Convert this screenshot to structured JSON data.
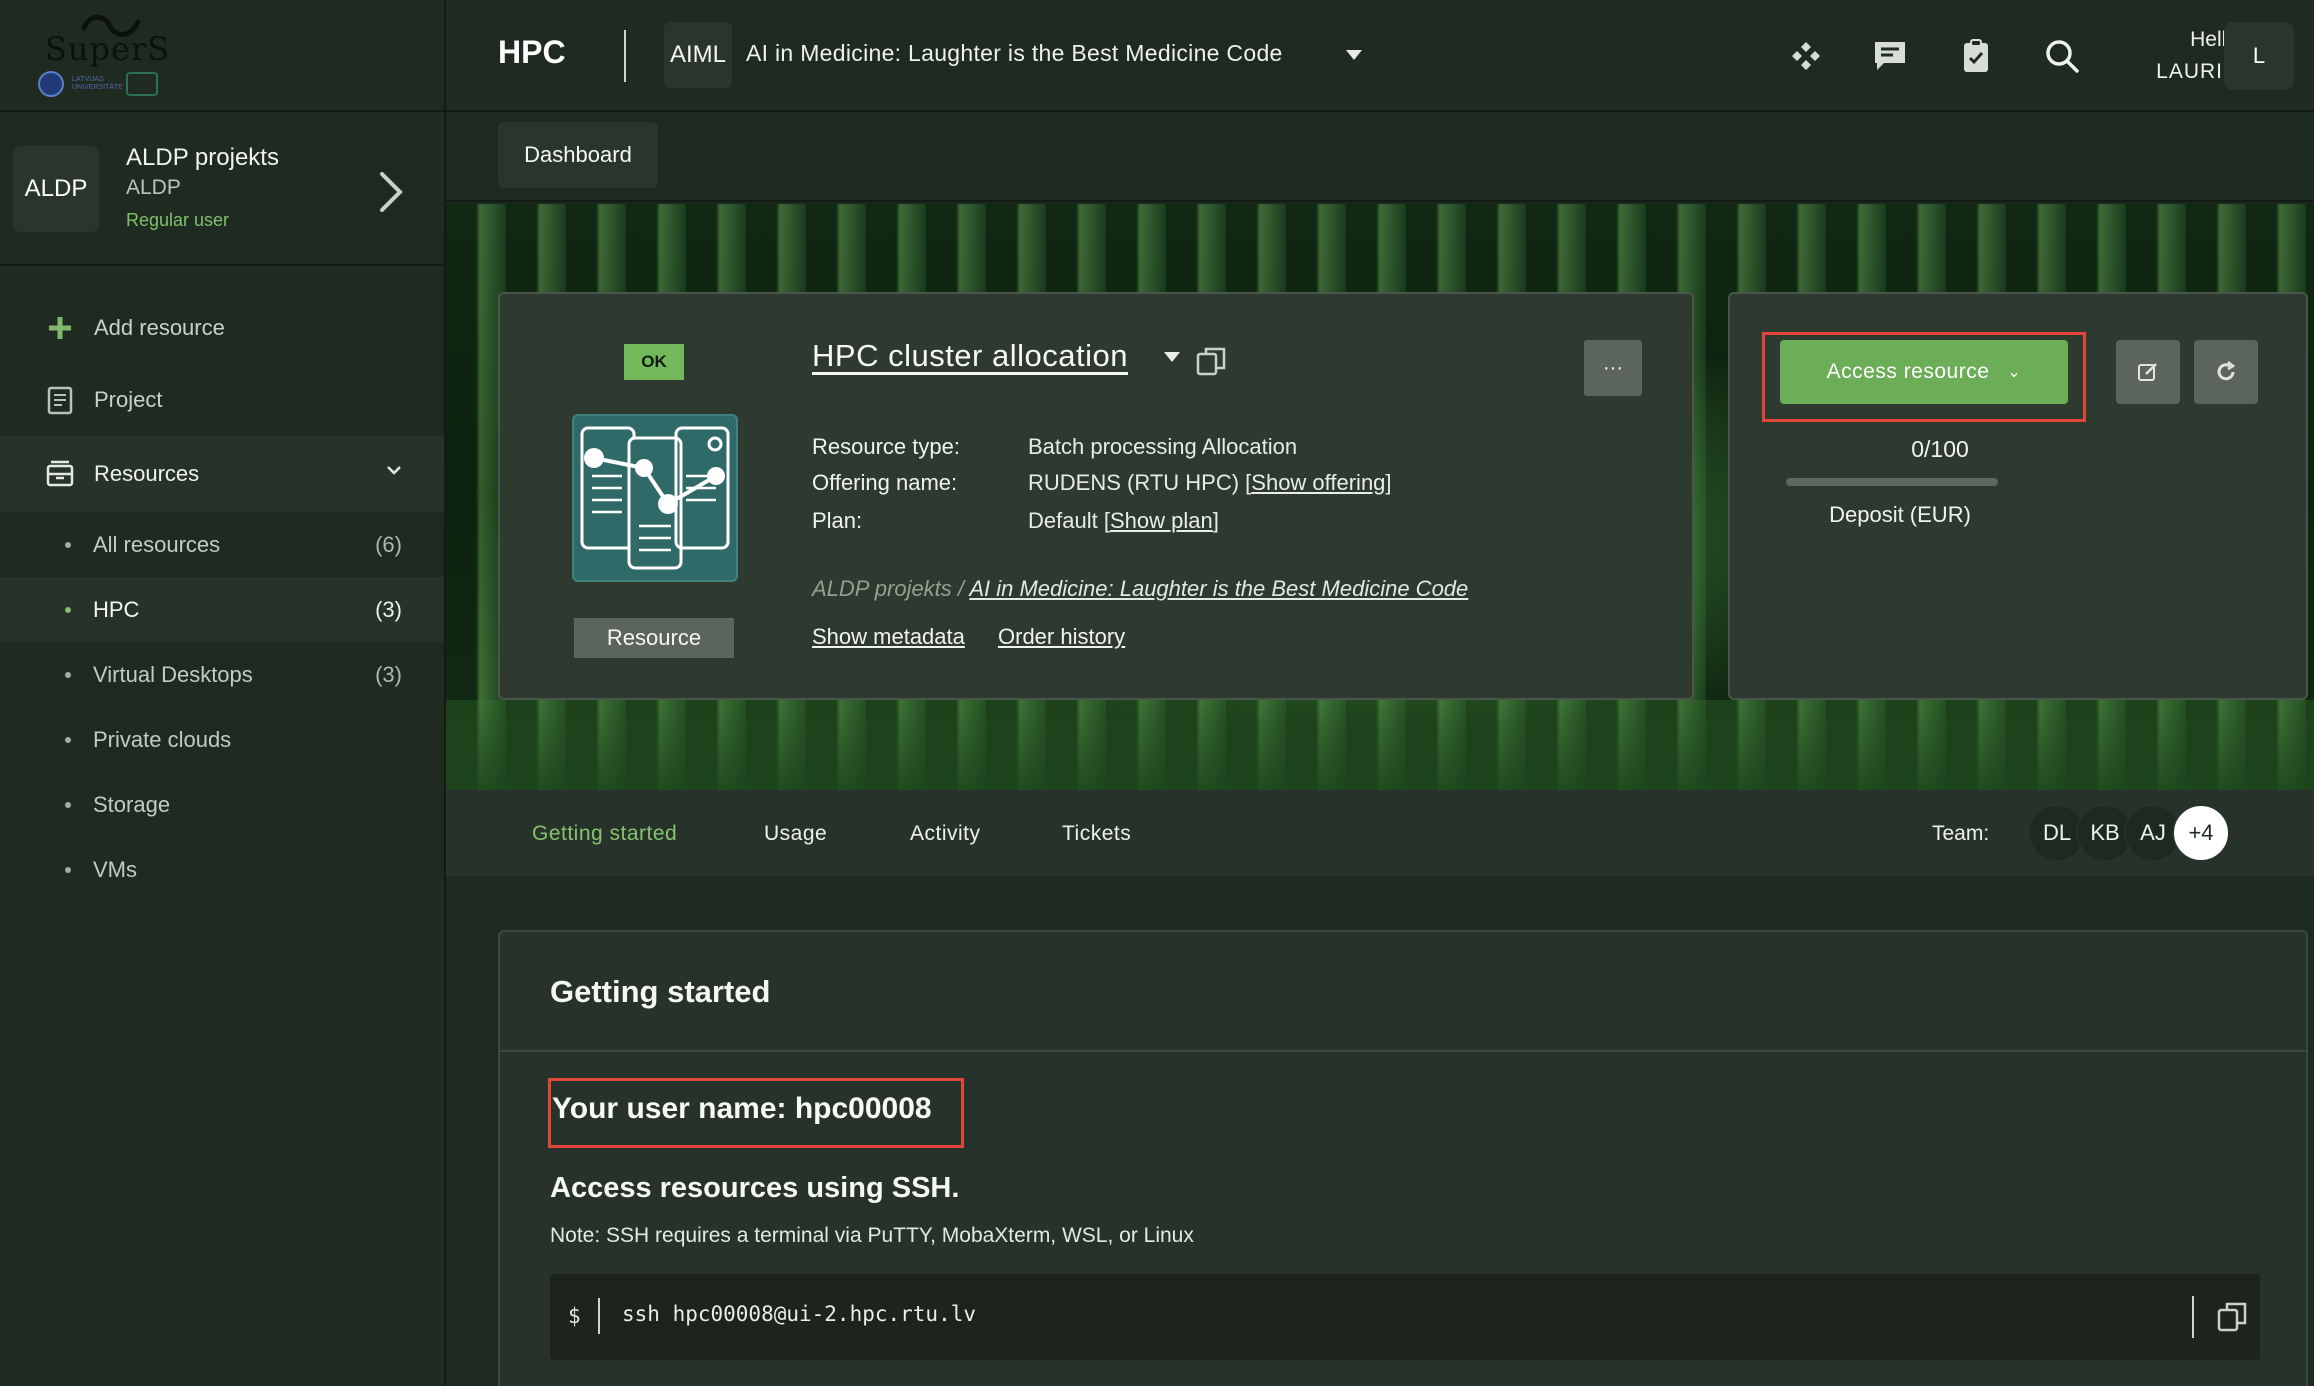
{
  "sidebar": {
    "logo": {
      "text": "SuperS",
      "sub_text": "LATVIJAS UNIVERSITĀTE"
    },
    "project": {
      "avatar": "ALDP",
      "name": "ALDP projekts",
      "code": "ALDP",
      "role": "Regular user"
    },
    "nav": {
      "add_resource": "Add resource",
      "project": "Project",
      "resources": "Resources"
    },
    "resources": [
      {
        "label": "All resources",
        "count": "(6)"
      },
      {
        "label": "HPC",
        "count": "(3)"
      },
      {
        "label": "Virtual Desktops",
        "count": "(3)"
      },
      {
        "label": "Private clouds",
        "count": ""
      },
      {
        "label": "Storage",
        "count": ""
      },
      {
        "label": "VMs",
        "count": ""
      }
    ]
  },
  "topbar": {
    "title": "HPC",
    "project_badge": "AIML",
    "project_name": "AI in Medicine: Laughter is the Best Medicine Code",
    "hello": "Hello",
    "user_name": "LAURIS",
    "user_initial": "L",
    "icons": [
      "apps-icon",
      "chat-icon",
      "clipboard-check-icon",
      "search-icon"
    ]
  },
  "breadcrumb": {
    "dashboard": "Dashboard"
  },
  "resource": {
    "status": "OK",
    "title": "HPC cluster allocation",
    "image_label": "Resource",
    "more": "···",
    "fields": [
      {
        "label": "Resource type:",
        "value": "Batch processing Allocation"
      },
      {
        "label": "Offering name:",
        "value": "RUDENS (RTU HPC) ",
        "link_open": "[",
        "link": "Show offering",
        "link_close": "]"
      },
      {
        "label": "Plan:",
        "value": "Default ",
        "link_open": "[",
        "link": "Show plan",
        "link_close": "]"
      }
    ],
    "project_path_prefix": "ALDP projekts / ",
    "project_path_link": "AI in Medicine: Laughter is the Best Medicine Code",
    "show_metadata": "Show metadata",
    "order_history": "Order history"
  },
  "side": {
    "access_button": "Access resource",
    "quota": "0/100",
    "quota_fraction": 0,
    "quota_label": "Deposit (EUR)"
  },
  "tabs": {
    "items": [
      "Getting started",
      "Usage",
      "Activity",
      "Tickets"
    ],
    "team_label": "Team:",
    "team": [
      "DL",
      "KB",
      "AJ",
      "+4"
    ]
  },
  "getting_started": {
    "title": "Getting started",
    "user_line": "Your user name: hpc00008",
    "ssh_title": "Access resources using SSH.",
    "ssh_note": "Note: SSH requires a terminal via PuTTY, MobaXterm, WSL, or Linux",
    "prompt": "$",
    "command": "ssh hpc00008@ui-2.hpc.rtu.lv"
  },
  "colors": {
    "accent_green": "#6bae57",
    "highlight_red": "#e0473a",
    "background": "#1d2a1f"
  }
}
